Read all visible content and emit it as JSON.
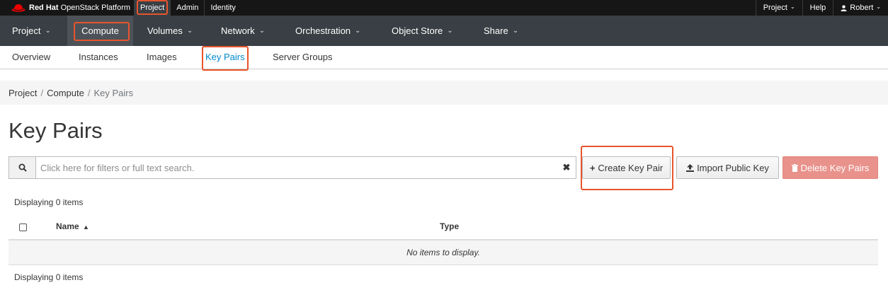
{
  "topbar": {
    "brand_bold": "Red Hat",
    "brand_rest": "OpenStack Platform",
    "nav": [
      "Project",
      "Admin",
      "Identity"
    ],
    "right": {
      "project": "Project",
      "help": "Help",
      "user": "Robert"
    }
  },
  "mainnav": [
    "Project",
    "Compute",
    "Volumes",
    "Network",
    "Orchestration",
    "Object Store",
    "Share"
  ],
  "subnav": [
    "Overview",
    "Instances",
    "Images",
    "Key Pairs",
    "Server Groups"
  ],
  "breadcrumb": [
    "Project",
    "Compute",
    "Key Pairs"
  ],
  "page": {
    "title": "Key Pairs",
    "search_placeholder": "Click here for filters or full text search.",
    "create_label": "Create Key Pair",
    "import_label": "Import Public Key",
    "delete_label": "Delete Key Pairs",
    "displaying_top": "Displaying 0 items",
    "displaying_bottom": "Displaying 0 items",
    "columns": [
      "Name",
      "Type"
    ],
    "empty_message": "No items to display."
  },
  "colors": {
    "highlight": "#e8542c",
    "link_active": "#0088ce",
    "danger": "#e8928b",
    "nav_bg": "#393f44"
  }
}
